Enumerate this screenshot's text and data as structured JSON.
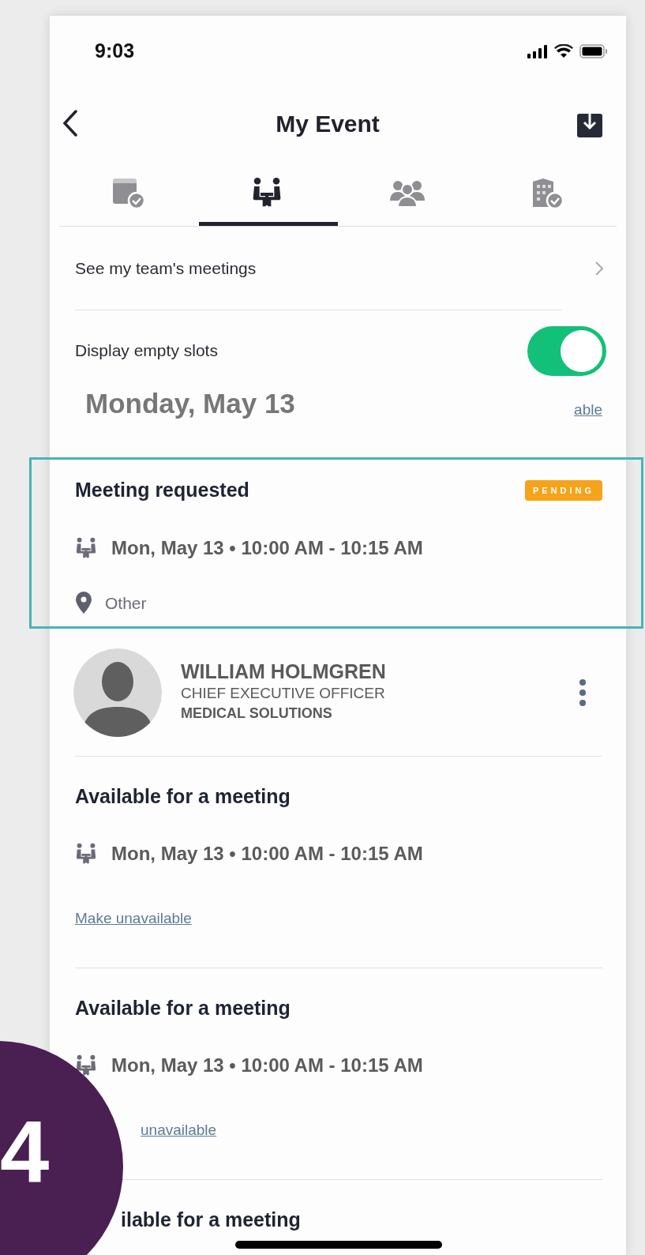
{
  "status_bar": {
    "time": "9:03"
  },
  "header": {
    "title": "My Event"
  },
  "tabs": [
    {
      "selected": false
    },
    {
      "selected": true
    },
    {
      "selected": false
    },
    {
      "selected": false
    }
  ],
  "team_link": {
    "label": "See my team's meetings"
  },
  "empty_slots": {
    "label": "Display empty slots",
    "on": true
  },
  "date_heading": {
    "title": "Monday, May 13",
    "partial_link": "able"
  },
  "meeting_request": {
    "title": "Meeting requested",
    "status": "PENDING",
    "time": "Mon, May 13 • 10:00 AM - 10:15 AM",
    "location": "Other"
  },
  "contact": {
    "name": "WILLIAM HOLMGREN",
    "job_title": "CHIEF EXECUTIVE OFFICER",
    "company": "MEDICAL SOLUTIONS"
  },
  "slots": [
    {
      "title": "Available for a meeting",
      "time": "Mon, May 13 • 10:00 AM - 10:15 AM",
      "action": "Make unavailable"
    },
    {
      "title": "Available for a meeting",
      "time": "Mon, May 13 • 10:00 AM - 10:15 AM",
      "action": "unavailable"
    },
    {
      "title": "ilable for a meeting"
    }
  ],
  "step_marker": {
    "number": "4"
  }
}
